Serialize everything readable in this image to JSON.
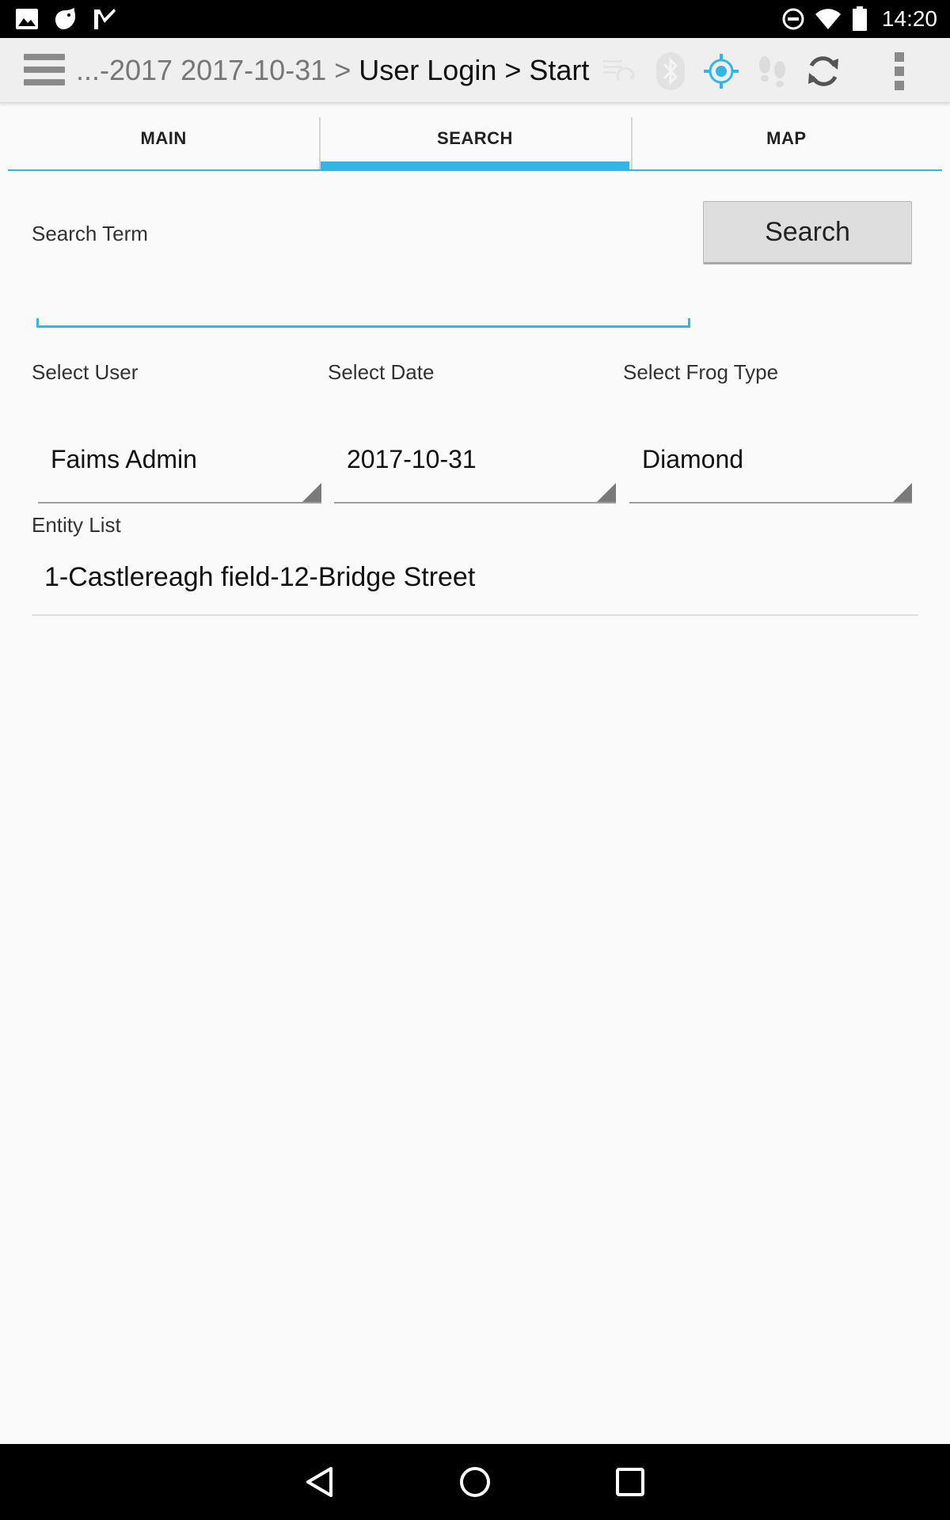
{
  "status_bar": {
    "time": "14:20",
    "left_icons": [
      "image-icon",
      "notification-bird-icon",
      "checkmark-flag-icon"
    ],
    "right_icons": [
      "do-not-disturb-icon",
      "wifi-icon",
      "battery-icon"
    ]
  },
  "action_bar": {
    "breadcrumb_prefix": "...-2017 2017-10-31",
    "separator_1": " > ",
    "crumb_2": "User Login",
    "separator_2": " > ",
    "crumb_3": "Start",
    "icons": [
      "sync-status-icon",
      "bluetooth-icon",
      "gps-location-icon",
      "tracking-footsteps-icon",
      "refresh-icon",
      "overflow-menu-icon"
    ],
    "accent_color": "#33b5e5"
  },
  "tabs": [
    {
      "label": "MAIN",
      "active": false
    },
    {
      "label": "SEARCH",
      "active": true
    },
    {
      "label": "MAP",
      "active": false
    }
  ],
  "search": {
    "term_label": "Search Term",
    "term_value": "",
    "button_label": "Search"
  },
  "filters": {
    "user": {
      "label": "Select User",
      "value": "Faims Admin"
    },
    "date": {
      "label": "Select Date",
      "value": "2017-10-31"
    },
    "frog_type": {
      "label": "Select Frog Type",
      "value": "Diamond"
    }
  },
  "entity_list": {
    "label": "Entity List",
    "items": [
      "1-Castlereagh field-12-Bridge Street"
    ]
  },
  "nav_bar": {
    "icons": [
      "back-icon",
      "home-icon",
      "recents-icon"
    ]
  }
}
